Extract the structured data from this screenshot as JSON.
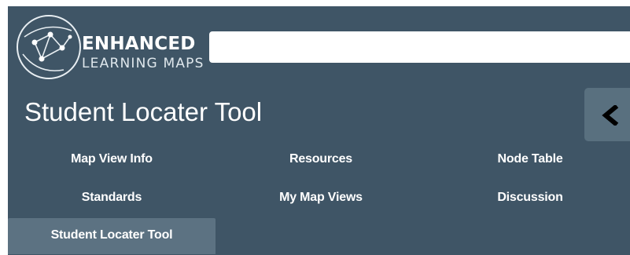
{
  "header": {
    "logo": {
      "line1": "ENHANCED",
      "line2": "LEARNING MAPS",
      "icon": "network-constellation-logo"
    },
    "search": {
      "value": "",
      "placeholder": ""
    }
  },
  "page": {
    "title": "Student Locater Tool"
  },
  "panel_toggle": {
    "icon": "chevron-left-icon"
  },
  "nav": {
    "items": [
      {
        "label": "Map View Info"
      },
      {
        "label": "Resources"
      },
      {
        "label": "Node Table"
      },
      {
        "label": "Standards"
      },
      {
        "label": "My Map Views"
      },
      {
        "label": "Discussion"
      },
      {
        "label": "Student Locater Tool"
      }
    ],
    "active_index": 6
  },
  "colors": {
    "panel_bg": "#3f5566",
    "active_tab_bg": "#5c7282",
    "toggle_bg": "#59707f",
    "text": "#ffffff"
  }
}
